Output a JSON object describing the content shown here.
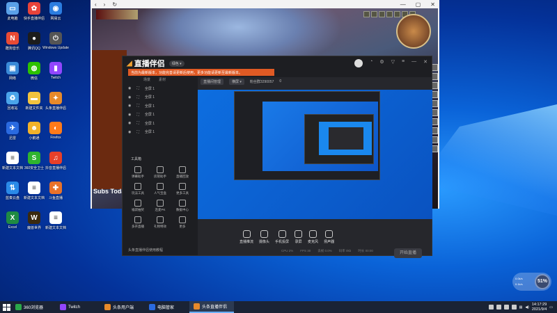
{
  "desktop": {
    "icons": [
      {
        "label": "此电脑",
        "color": "#5aa0e8",
        "glyph": "▭"
      },
      {
        "label": "快手直播伴侣",
        "color": "#e8433a",
        "glyph": "✿"
      },
      {
        "label": "网易云",
        "color": "#2b7de0",
        "glyph": "◉"
      },
      {
        "label": "酷狗音乐",
        "color": "#e94b35",
        "glyph": "N"
      },
      {
        "label": "腾讯QQ",
        "color": "#1c1c1c",
        "glyph": "●"
      },
      {
        "label": "Windows Update",
        "color": "#555",
        "glyph": "⏻"
      },
      {
        "label": "网络",
        "color": "#3a8ad8",
        "glyph": "▣"
      },
      {
        "label": "微信",
        "color": "#2dc100",
        "glyph": "◍"
      },
      {
        "label": "Twitch",
        "color": "#9146ff",
        "glyph": "▮"
      },
      {
        "label": "回收站",
        "color": "#4aa4ea",
        "glyph": "♻"
      },
      {
        "label": "新建文件夹",
        "color": "#f1c33f",
        "glyph": "▬"
      },
      {
        "label": "头条直播伴侣",
        "color": "#e88a2a",
        "glyph": "✦"
      },
      {
        "label": "迅雷",
        "color": "#2a6ae0",
        "glyph": "✈"
      },
      {
        "label": "小鹅通",
        "color": "#f2b22a",
        "glyph": "☻"
      },
      {
        "label": "Firefox",
        "color": "#ff7a1a",
        "glyph": "◐"
      },
      {
        "label": "新建文本文档",
        "color": "#ffffff",
        "glyph": "≡"
      },
      {
        "label": "360安全卫士",
        "color": "#2fb42f",
        "glyph": "S"
      },
      {
        "label": "抖音直播伴侣",
        "color": "#e8402a",
        "glyph": "♫"
      },
      {
        "label": "蓝奏云盘",
        "color": "#2a8ae8",
        "glyph": "⇅"
      },
      {
        "label": "新建文本文档",
        "color": "#ffffff",
        "glyph": "≡"
      },
      {
        "label": "斗鱼直播",
        "color": "#e8722a",
        "glyph": "✚"
      },
      {
        "label": "Excel",
        "color": "#1f8a43",
        "glyph": "X"
      },
      {
        "label": "魔兽世界",
        "color": "#3a2a10",
        "glyph": "W"
      },
      {
        "label": "新建文本文档",
        "color": "#ffffff",
        "glyph": "≡"
      }
    ]
  },
  "browser": {
    "nav": [
      "‹",
      "›",
      "↻"
    ],
    "window_controls": [
      "—",
      "▢",
      "✕"
    ],
    "game": {
      "subtitle": "Subs Today"
    }
  },
  "app": {
    "title": "直播伴侣",
    "version_badge": "绿色 ▾",
    "notice": "当前为最新版本，功能完善请更新后使用，更多功能请更新至最新版本。",
    "left_tabs": [
      "场景",
      "素材"
    ],
    "scenes": [
      "全屏 1",
      "全屏 1",
      "全屏 1",
      "全屏 1",
      "全屏 1",
      "全屏 1"
    ],
    "tools_header": "工具箱",
    "tools": [
      "弹幕助手",
      "房管助手",
      "直播回放",
      "玩法工具",
      "人气宝盒",
      "更多工具",
      "福袋抽奖",
      "连麦PK",
      "数据中心",
      "多开直播",
      "礼物特效",
      "更多"
    ],
    "live_bar": "头条直播伴侣使用教程",
    "top_info": [
      "服务器优选",
      "横竖屏",
      "粉丝群3290057",
      "0"
    ],
    "top_tabs": [
      "直播间管理",
      "横屏 ▾"
    ],
    "controls": [
      "直播推流",
      "摄像头",
      "手机投屏",
      "录屏",
      "麦克风",
      "扬声器"
    ],
    "go_live": "开始直播",
    "status": [
      "CPU 2%",
      "FPS 30",
      "丢帧 0.0%",
      "码率 0kb",
      "时长 00:00"
    ]
  },
  "taskbar": {
    "items": [
      {
        "label": "360浏览器",
        "color": "#2aa84a"
      },
      {
        "label": "Twitch",
        "color": "#9146ff"
      },
      {
        "label": "头条用户端",
        "color": "#e88a2a"
      },
      {
        "label": "电脑管家",
        "color": "#2a6ae0"
      },
      {
        "label": "头条直播伴侣",
        "color": "#e88a2a",
        "active": true
      }
    ],
    "time": "14:17:29",
    "date": "2021/9/4"
  },
  "net_widget": {
    "up": "0.0k/s",
    "down": "0.1k/s",
    "percent": "51%"
  }
}
